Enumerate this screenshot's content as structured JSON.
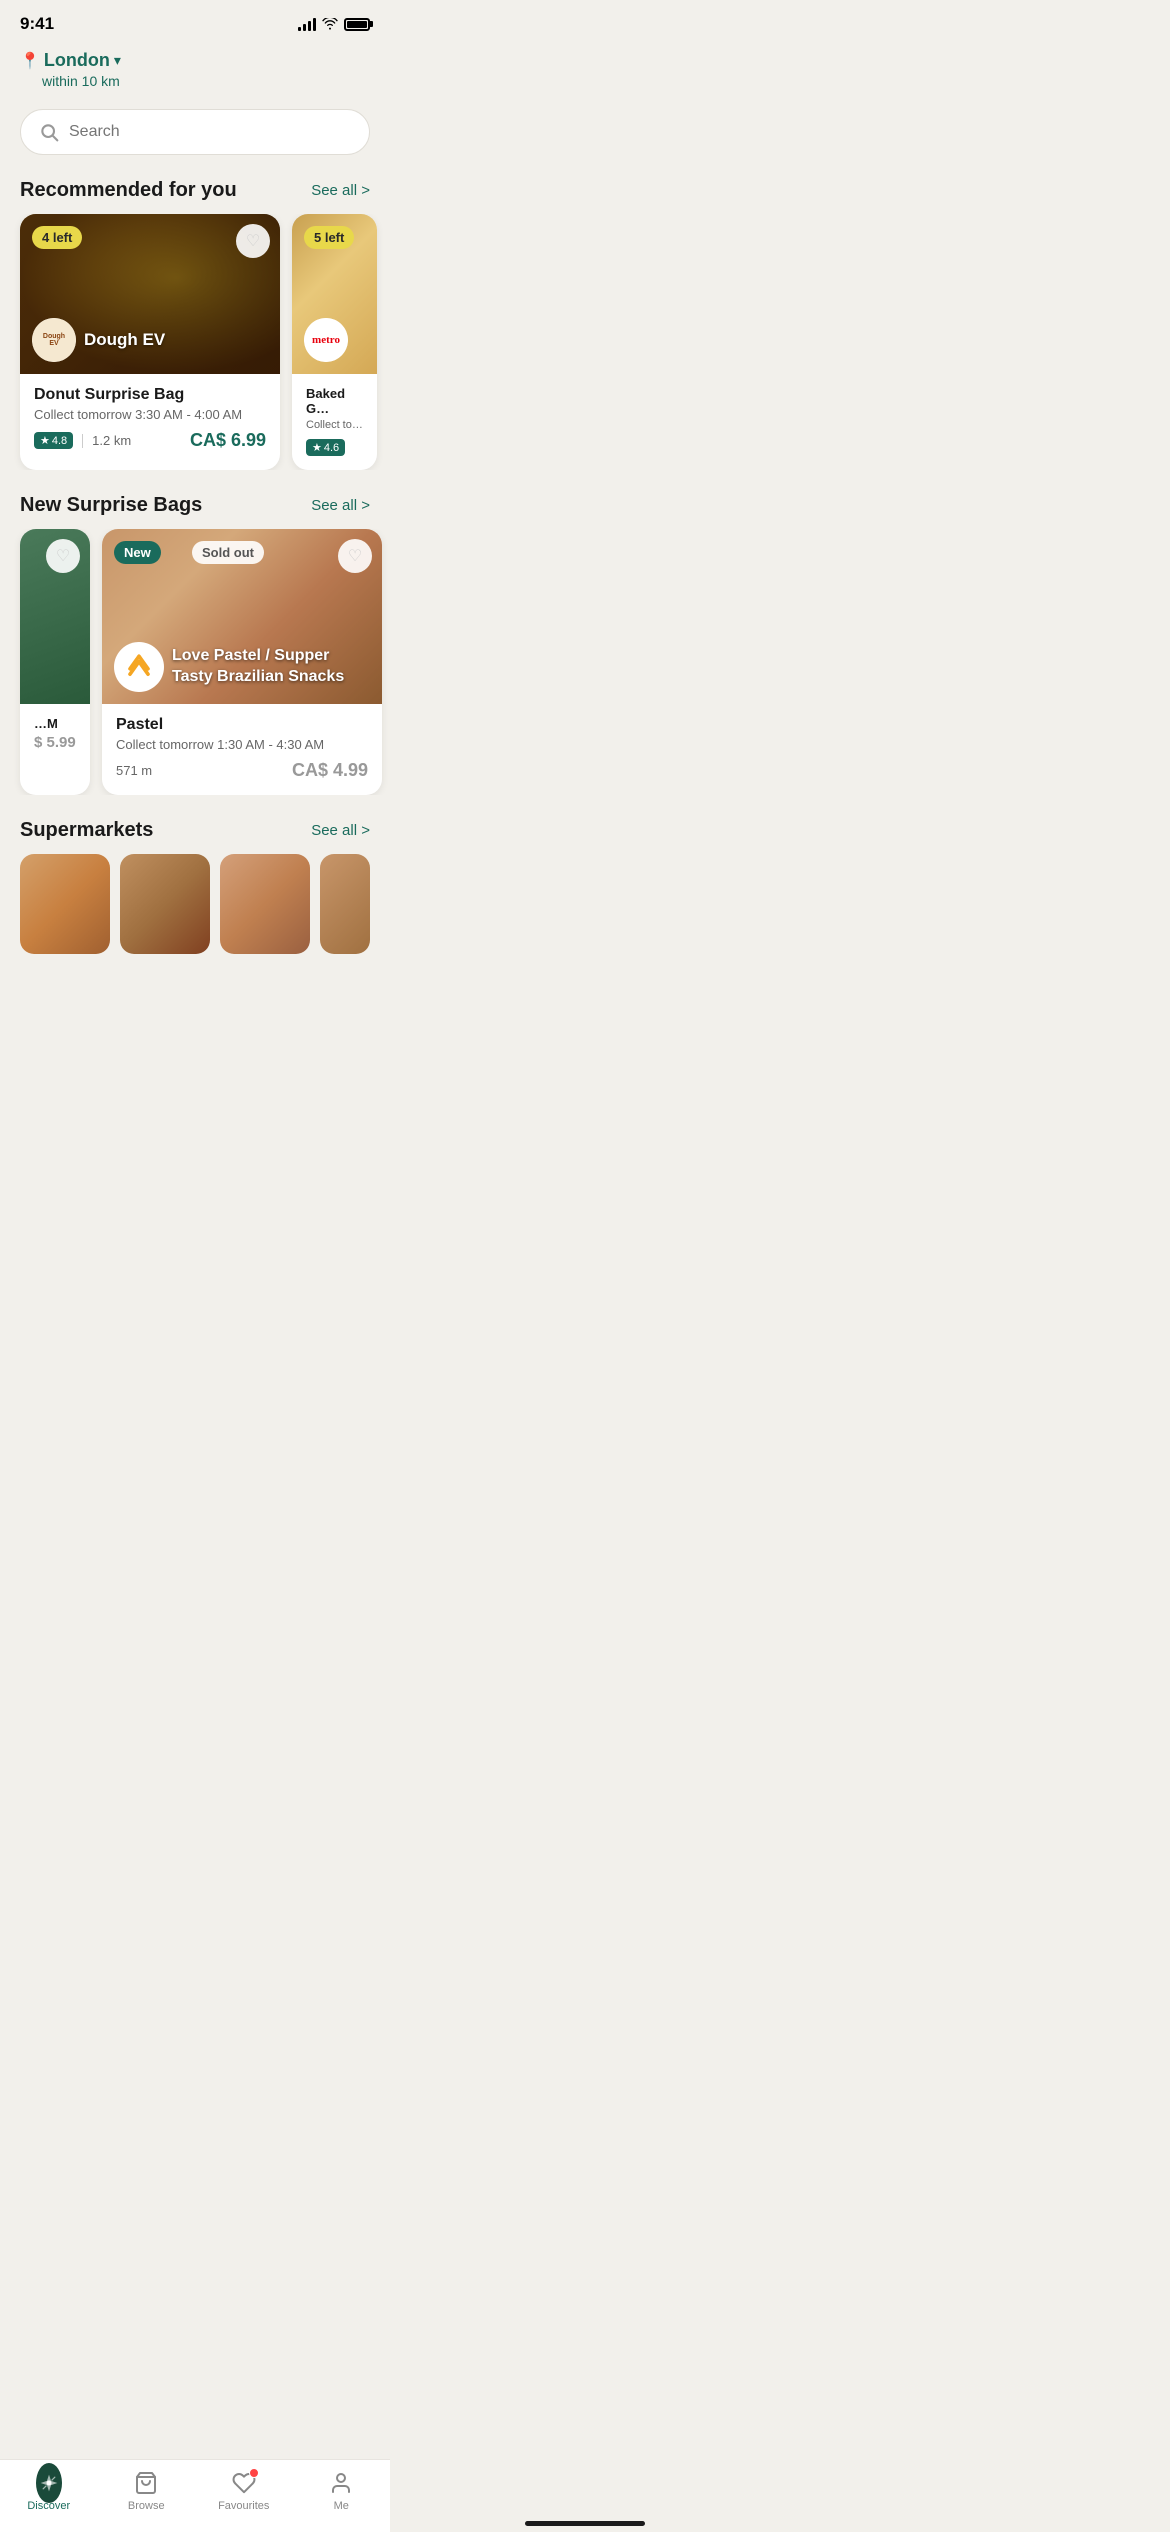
{
  "statusBar": {
    "time": "9:41"
  },
  "location": {
    "pin_icon": "📍",
    "city": "London",
    "dropdown_icon": "⌄",
    "radius": "within 10 km"
  },
  "search": {
    "placeholder": "Search"
  },
  "recommended": {
    "title": "Recommended for you",
    "see_all": "See all >",
    "items": [
      {
        "id": "dough-ev",
        "badge": "4 left",
        "store_name": "Dough EV",
        "title": "Donut Surprise Bag",
        "collect": "Collect tomorrow 3:30 AM - 4:00 AM",
        "rating": "4.8",
        "distance": "1.2 km",
        "price": "CA$ 6.99"
      },
      {
        "id": "metro",
        "badge": "5 left",
        "store_name": "metro",
        "title": "Baked G...",
        "collect": "Collect to...",
        "rating": "4.6",
        "distance": "",
        "price": ""
      }
    ]
  },
  "newBags": {
    "title": "New Surprise Bags",
    "see_all": "See all >",
    "items": [
      {
        "id": "partial-left",
        "price": "$ 5.99",
        "partial": true
      },
      {
        "id": "love-pastel",
        "badge_new": "New",
        "badge_sold": "Sold out",
        "store_name": "Love Pastel / Supper Tasty Brazilian Snacks",
        "title": "Pastel",
        "collect": "Collect tomorrow 1:30 AM - 4:30 AM",
        "distance": "571 m",
        "price": "CA$ 4.99"
      }
    ]
  },
  "supermarkets": {
    "title": "Supermarkets",
    "see_all": "See all >"
  },
  "bottomNav": {
    "items": [
      {
        "id": "discover",
        "label": "Discover",
        "active": true
      },
      {
        "id": "browse",
        "label": "Browse",
        "active": false
      },
      {
        "id": "favourites",
        "label": "Favourites",
        "active": false
      },
      {
        "id": "me",
        "label": "Me",
        "active": false
      }
    ]
  }
}
